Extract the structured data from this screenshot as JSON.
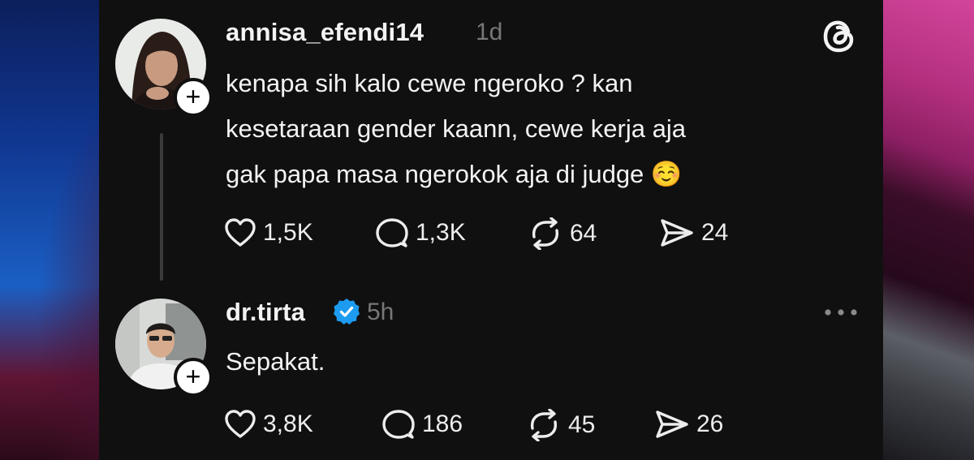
{
  "posts": [
    {
      "username": "annisa_efendi14",
      "time": "1d",
      "text_lines": [
        "kenapa sih kalo cewe ngeroko ? kan",
        "kesetaraan gender kaann, cewe kerja aja",
        "gak papa masa ngerokok aja di judge ☺️"
      ],
      "actions": {
        "likes": "1,5K",
        "replies": "1,3K",
        "reposts": "64",
        "shares": "24"
      },
      "follow_badge": "+",
      "avatar_icon": "avatar-woman"
    },
    {
      "username": "dr.tirta",
      "verified": true,
      "time": "5h",
      "text": "Sepakat.",
      "actions": {
        "likes": "3,8K",
        "replies": "186",
        "reposts": "45",
        "shares": "26"
      },
      "follow_badge": "+",
      "avatar_icon": "avatar-man"
    }
  ],
  "icons": {
    "app_logo": "threads-logo-icon",
    "more": "more-options-icon",
    "like": "heart-icon",
    "reply": "comment-icon",
    "repost": "repost-icon",
    "share": "send-icon",
    "verified": "verified-badge-icon"
  },
  "colors": {
    "panel_bg": "#101010",
    "text": "#f3f3f3",
    "muted": "#777777",
    "verified_blue": "#1d9bf0"
  }
}
